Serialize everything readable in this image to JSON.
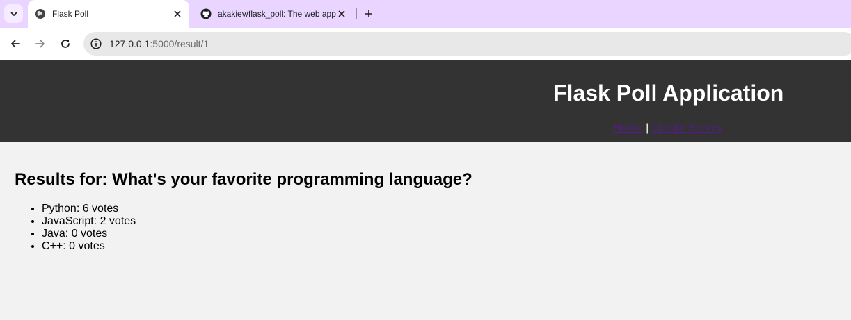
{
  "browser": {
    "tabs": [
      {
        "title": "Flask Poll",
        "active": true,
        "favicon": "globe-icon"
      },
      {
        "title": "akakiev/flask_poll: The web app",
        "active": false,
        "favicon": "github-icon"
      }
    ],
    "address": {
      "host": "127.0.0.1",
      "path": ":5000/result/1"
    },
    "colors": {
      "tabstrip": "#e9d5ff",
      "omnibox": "#e8e8e8"
    }
  },
  "site": {
    "title": "Flask Poll Application",
    "nav": {
      "home": "Home",
      "separator": "|",
      "create": "Create Survey"
    },
    "colors": {
      "header_bg": "#333333",
      "link": "#551a8b",
      "page_bg": "#f2f2f2"
    }
  },
  "results": {
    "heading": "Results for: What's your favorite programming language?",
    "items": [
      "Python: 6 votes",
      "JavaScript: 2 votes",
      "Java: 0 votes",
      "C++: 0 votes"
    ]
  }
}
